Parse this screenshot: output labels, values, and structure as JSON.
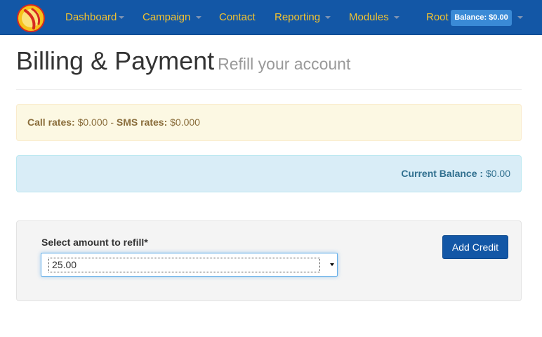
{
  "navbar": {
    "logo_icon": "brand-logo-icon",
    "items": [
      {
        "label": "Dashboard",
        "dropdown": true
      },
      {
        "label": "Campaign",
        "dropdown": true
      },
      {
        "label": "Contact",
        "dropdown": false
      },
      {
        "label": "Reporting",
        "dropdown": true
      },
      {
        "label": "Modules",
        "dropdown": true
      }
    ],
    "user": "Root",
    "balance_badge": "Balance: $0.00",
    "colors": {
      "background": "#1357a6",
      "link": "#f2c230",
      "badge": "#3a8ad6"
    }
  },
  "page": {
    "title": "Billing & Payment",
    "subtitle": "Refill your account"
  },
  "rates": {
    "call_label": "Call rates:",
    "call_value": "$0.000",
    "separator": "-",
    "sms_label": "SMS rates:",
    "sms_value": "$0.000"
  },
  "balance": {
    "label": "Current Balance :",
    "value": "$0.00"
  },
  "refill": {
    "label": "Select amount to refill*",
    "selected_amount": "25.00",
    "button_label": "Add Credit"
  }
}
